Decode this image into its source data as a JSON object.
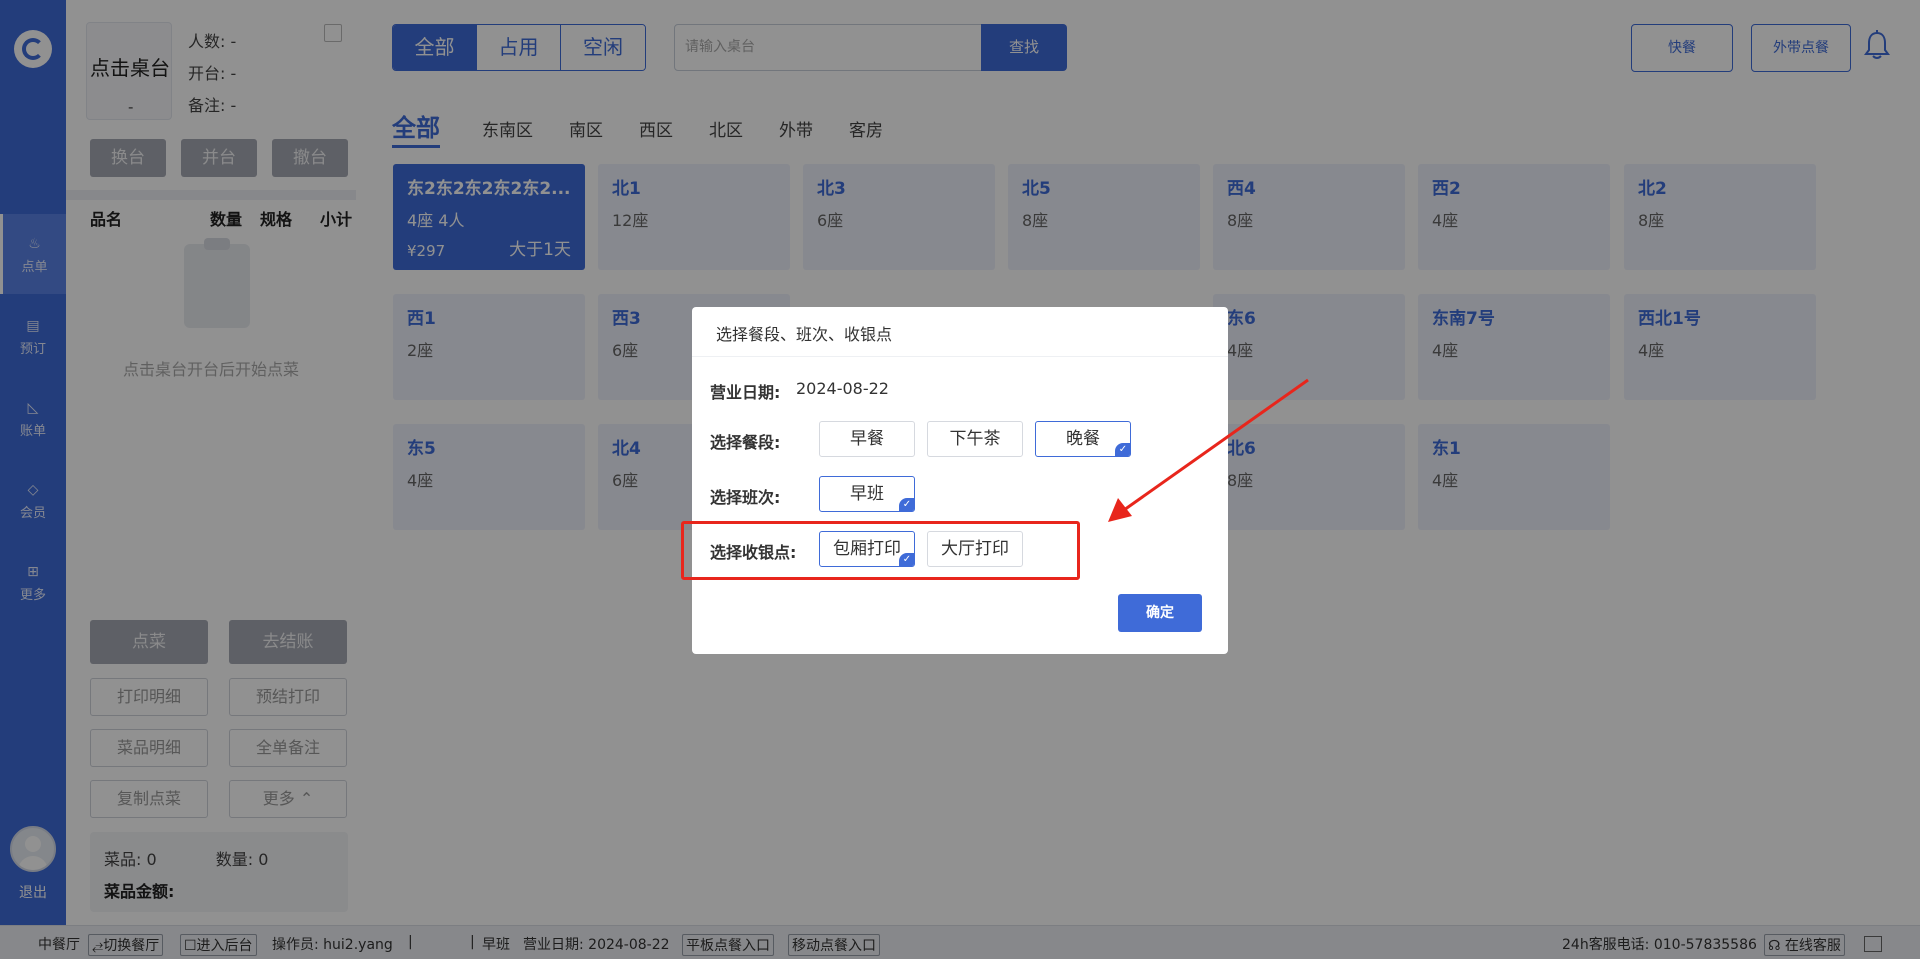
{
  "nav": {
    "items": [
      {
        "icon": "chef-hat-icon",
        "label": "点单",
        "glyph": "♨"
      },
      {
        "icon": "book-icon",
        "label": "预订",
        "glyph": "▤"
      },
      {
        "icon": "chart-icon",
        "label": "账单",
        "glyph": "◺"
      },
      {
        "icon": "diamond-icon",
        "label": "会员",
        "glyph": "◇"
      },
      {
        "icon": "grid-icon",
        "label": "更多",
        "glyph": "⊞"
      }
    ],
    "logout": "退出"
  },
  "panel": {
    "desk_name": "点击桌台",
    "desk_dash": "-",
    "people": "人数: -",
    "open": "开台: -",
    "remark": "备注: -",
    "btn_change": "换台",
    "btn_merge": "并台",
    "btn_cancel": "撤台",
    "col_name": "品名",
    "col_qty": "数量",
    "col_spec": "规格",
    "col_subtotal": "小计",
    "empty_tip": "点击桌台开台后开始点菜",
    "btn_order": "点菜",
    "btn_checkout": "去结账",
    "btn_print_detail": "打印明细",
    "btn_pre_print": "预结打印",
    "btn_dish_detail": "菜品明细",
    "btn_order_remark": "全单备注",
    "btn_copy": "复制点菜",
    "btn_more": "更多 ⌃",
    "sum_dishes": "菜品: 0",
    "sum_qty": "数量: 0",
    "sum_amount": "菜品金额:"
  },
  "main": {
    "seg": [
      "全部",
      "占用",
      "空闲"
    ],
    "search_placeholder": "请输入桌台",
    "search_btn": "查找",
    "btn_fast": "快餐",
    "btn_takeout": "外带点餐",
    "areas": [
      "全部",
      "东南区",
      "南区",
      "西区",
      "北区",
      "外带",
      "客房"
    ],
    "tables": [
      {
        "name": "东2东2东2东2东2...",
        "seats": "4座   4人",
        "price": "¥297",
        "duration": "大于1天",
        "busy": true
      },
      {
        "name": "北1",
        "seats": "12座"
      },
      {
        "name": "北3",
        "seats": "6座"
      },
      {
        "name": "北5",
        "seats": "8座"
      },
      {
        "name": "西4",
        "seats": "8座"
      },
      {
        "name": "西2",
        "seats": "4座"
      },
      {
        "name": "北2",
        "seats": "8座"
      },
      {
        "name": "西1",
        "seats": "2座"
      },
      {
        "name": "西3",
        "seats": "6座"
      },
      {
        "name": "东6",
        "seats": "4座"
      },
      {
        "name": "东南7号",
        "seats": "4座"
      },
      {
        "name": "西北1号",
        "seats": "4座"
      },
      {
        "name": "东5",
        "seats": "4座"
      },
      {
        "name": "北4",
        "seats": "6座"
      },
      {
        "name": "北6",
        "seats": "8座"
      },
      {
        "name": "东1",
        "seats": "4座"
      }
    ]
  },
  "footer": {
    "restaurant": "中餐厅",
    "switch": "⥄切换餐厅",
    "backend": "☐进入后台",
    "operator": "操作员: hui2.yang",
    "sep1": "|",
    "sep2": "|",
    "shift": "早班",
    "date": "营业日期: 2024-08-22",
    "tablet": "平板点餐入口",
    "mobile": "移动点餐入口",
    "hotline": "24h客服电话: 010-57835586",
    "online": "☊ 在线客服"
  },
  "modal": {
    "title": "选择餐段、班次、收银点",
    "date_label": "营业日期:",
    "date_value": "2024-08-22",
    "meal_label": "选择餐段:",
    "meals": [
      "早餐",
      "下午茶",
      "晚餐"
    ],
    "shift_label": "选择班次:",
    "shifts": [
      "早班"
    ],
    "cashier_label": "选择收银点:",
    "cashiers": [
      "包厢打印",
      "大厅打印"
    ],
    "confirm": "确定"
  },
  "colors": {
    "primary": "#3f6bd8",
    "annotation_red": "#e8261c"
  }
}
